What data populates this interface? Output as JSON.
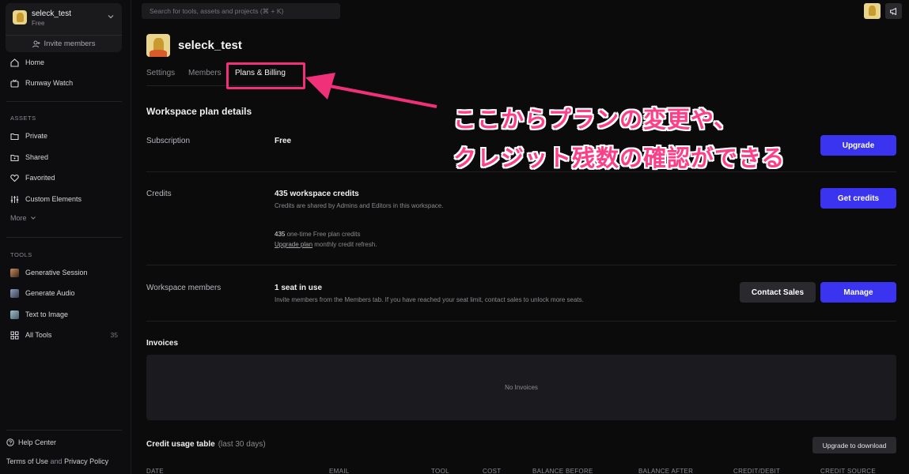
{
  "sidebar": {
    "workspace_name": "seleck_test",
    "workspace_plan": "Free",
    "invite_label": "Invite members",
    "nav": [
      {
        "label": "Home",
        "icon": "home-icon"
      },
      {
        "label": "Runway Watch",
        "icon": "tv-icon"
      }
    ],
    "assets_header": "ASSETS",
    "assets": [
      {
        "label": "Private",
        "icon": "folder-icon"
      },
      {
        "label": "Shared",
        "icon": "folder-shared-icon"
      },
      {
        "label": "Favorited",
        "icon": "heart-icon"
      },
      {
        "label": "Custom Elements",
        "icon": "sliders-icon"
      }
    ],
    "more_label": "More",
    "tools_header": "TOOLS",
    "tools": [
      {
        "label": "Generative Session",
        "icon": "generative-session-thumb",
        "color": "#8a5a3c"
      },
      {
        "label": "Generate Audio",
        "icon": "generate-audio-thumb",
        "color": "#5a6a8a"
      },
      {
        "label": "Text to Image",
        "icon": "text-to-image-thumb",
        "color": "#6a8a9a"
      },
      {
        "label": "All Tools",
        "icon": "grid-icon",
        "count": "35"
      }
    ],
    "help_label": "Help Center",
    "terms_label": "Terms of Use",
    "and_label": "and",
    "privacy_label": "Privacy Policy"
  },
  "topbar": {
    "search_placeholder": "Search for tools, assets and projects (⌘ + K)"
  },
  "header": {
    "title": "seleck_test",
    "tabs": [
      "Settings",
      "Members",
      "Plans & Billing"
    ],
    "active_tab": "Plans & Billing"
  },
  "plan": {
    "section_title": "Workspace plan details",
    "subscription_label": "Subscription",
    "subscription_value": "Free",
    "upgrade_button": "Upgrade",
    "credits_label": "Credits",
    "credits_value": "435 workspace credits",
    "credits_desc": "Credits are shared by Admins and Editors in this workspace.",
    "onetime_amount": "435",
    "onetime_text": " one-time Free plan credits",
    "upgrade_plan_link": "Upgrade plan",
    "refresh_text": " monthly credit refresh.",
    "get_credits_button": "Get credits",
    "members_label": "Workspace members",
    "members_value": "1 seat in use",
    "members_desc": "Invite members from the Members tab. If you have reached your seat limit, contact sales to unlock more seats.",
    "contact_sales_button": "Contact Sales",
    "manage_button": "Manage"
  },
  "invoices": {
    "title": "Invoices",
    "empty": "No Invoices"
  },
  "usage": {
    "title": "Credit usage table",
    "range": "(last 30 days)",
    "download_button": "Upgrade to download",
    "columns": [
      "DATE",
      "EMAIL",
      "TOOL",
      "COST",
      "BALANCE BEFORE",
      "BALANCE AFTER",
      "CREDIT/DEBIT",
      "CREDIT SOURCE"
    ]
  },
  "annotation": {
    "line1": "ここからプランの変更や、",
    "line2": "クレジット残数の確認ができる",
    "color": "#ff3e88"
  },
  "colors": {
    "accent": "#3a33f0",
    "highlight": "#f1307a"
  }
}
